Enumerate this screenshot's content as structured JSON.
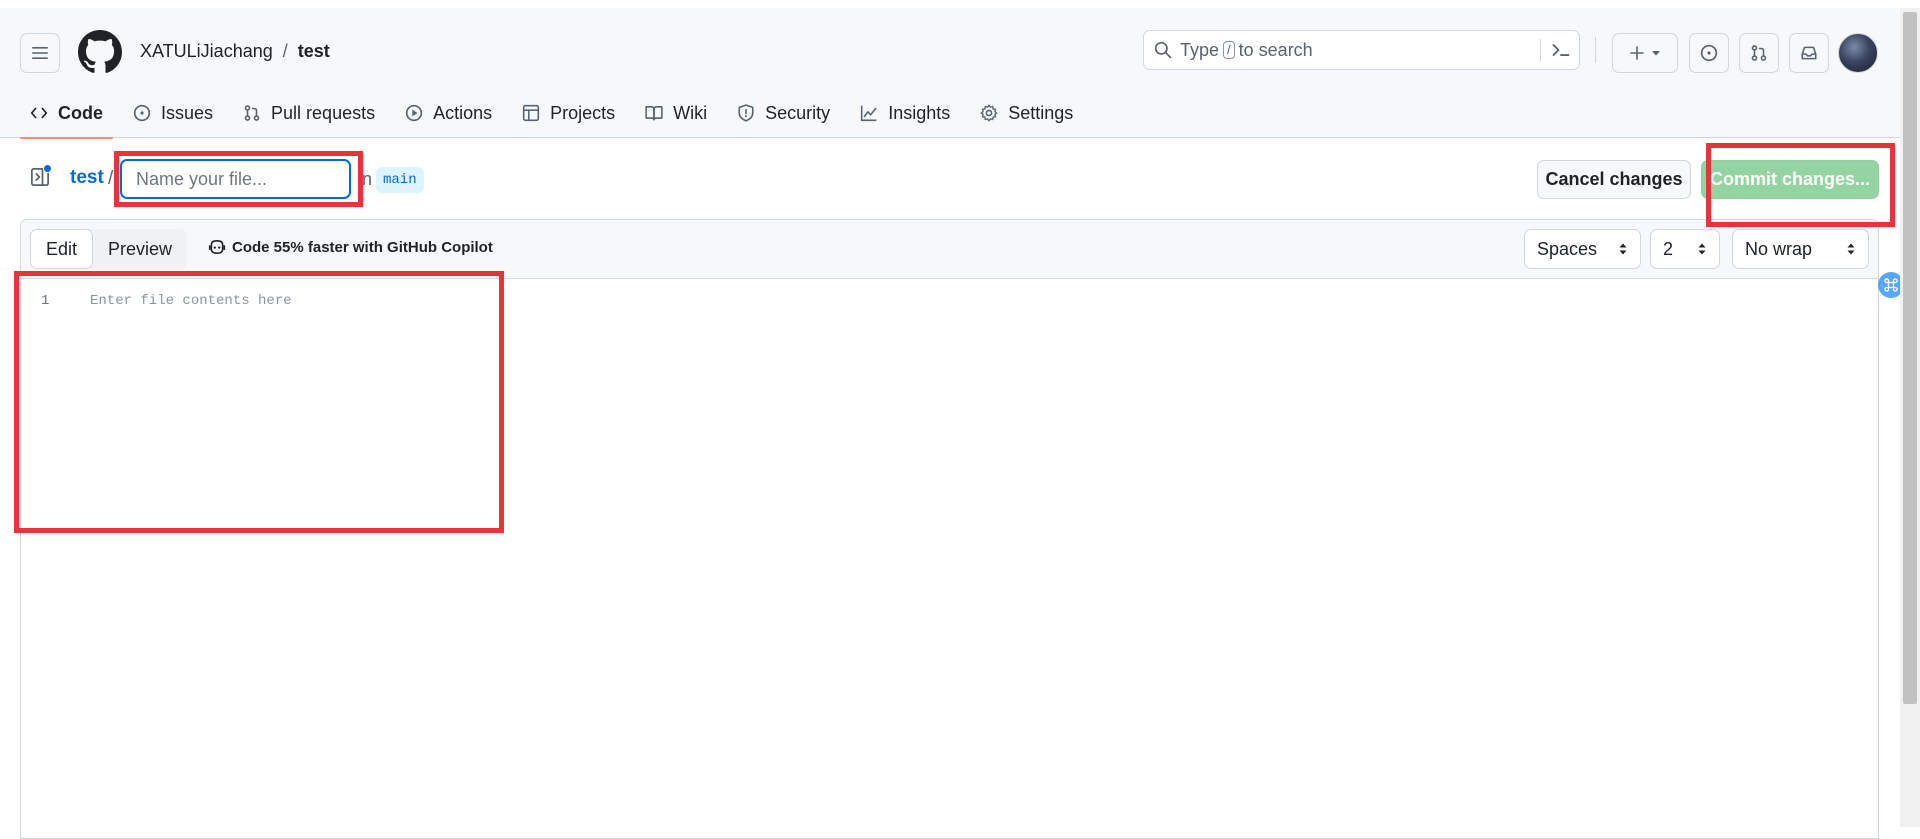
{
  "header": {
    "owner": "XATULiJiachang",
    "separator": "/",
    "repo": "test",
    "search": {
      "prefix": "Type",
      "key": "/",
      "suffix": "to search"
    }
  },
  "tabs": [
    {
      "label": "Code",
      "icon": "code-icon",
      "active": true
    },
    {
      "label": "Issues",
      "icon": "issue-opened-icon"
    },
    {
      "label": "Pull requests",
      "icon": "git-pull-request-icon"
    },
    {
      "label": "Actions",
      "icon": "play-icon"
    },
    {
      "label": "Projects",
      "icon": "table-icon"
    },
    {
      "label": "Wiki",
      "icon": "book-icon"
    },
    {
      "label": "Security",
      "icon": "shield-icon"
    },
    {
      "label": "Insights",
      "icon": "graph-icon"
    },
    {
      "label": "Settings",
      "icon": "gear-icon"
    }
  ],
  "file_bar": {
    "repo_link": "test",
    "slash": "/",
    "filename_placeholder": "Name your file...",
    "in_text": "in",
    "branch": "main",
    "cancel_label": "Cancel changes",
    "commit_label": "Commit changes..."
  },
  "editor": {
    "edit_label": "Edit",
    "preview_label": "Preview",
    "copilot_text": "Code 55% faster with GitHub Copilot",
    "indent_mode": "Spaces",
    "indent_size": "2",
    "wrap_mode": "No wrap",
    "line_number": "1",
    "placeholder": "Enter file contents here"
  },
  "colors": {
    "accent": "#0969da",
    "commit_button": "#94d3a2",
    "active_tab_underline": "#fd8c73",
    "highlight": "#e5343a"
  }
}
